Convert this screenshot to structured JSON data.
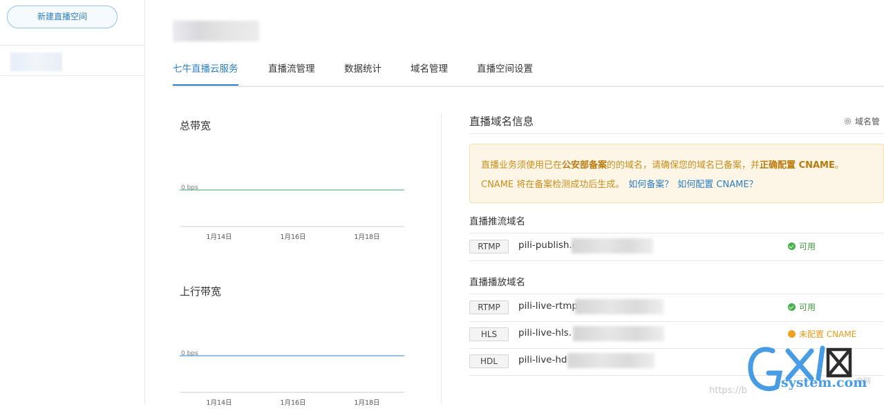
{
  "sidebar": {
    "new_space_label": "新建直播空间"
  },
  "tabs": [
    {
      "label": "七牛直播云服务",
      "active": true
    },
    {
      "label": "直播流管理",
      "active": false
    },
    {
      "label": "数据统计",
      "active": false
    },
    {
      "label": "域名管理",
      "active": false
    },
    {
      "label": "直播空间设置",
      "active": false
    }
  ],
  "charts": {
    "total_bandwidth": {
      "title": "总带宽"
    },
    "upstream_bandwidth": {
      "title": "上行带宽"
    }
  },
  "chart_data": [
    {
      "type": "line",
      "title": "总带宽",
      "x": [
        "1月14日",
        "1月16日",
        "1月18日"
      ],
      "series": [
        {
          "values": [
            0,
            0,
            0
          ]
        }
      ],
      "y_ticks": [
        "0 bps"
      ],
      "line_color": "#3aa06a",
      "grid": false
    },
    {
      "type": "line",
      "title": "上行带宽",
      "x": [
        "1月14日",
        "1月16日",
        "1月18日"
      ],
      "series": [
        {
          "values": [
            0,
            0,
            0
          ]
        }
      ],
      "y_ticks": [
        "0 bps"
      ],
      "line_color": "#2b7fc3",
      "grid": false
    }
  ],
  "domain_info": {
    "title": "直播域名信息",
    "manage_link": "域名管",
    "notice": {
      "line1_pre": "直播业务须使用已在",
      "line1_bold1": "公安部备案",
      "line1_mid": "的的域名，请确保您的域名已备案，并",
      "line1_bold2": "正确配置 CNAME",
      "line1_end": "。",
      "line2": "CNAME 将在备案检测成功后生成。",
      "link_filing": "如何备案？",
      "link_cname": "如何配置 CNAME？"
    },
    "publish_section": {
      "label": "直播推流域名",
      "rows": [
        {
          "protocol": "RTMP",
          "domain": "pili-publish.c",
          "status": "可用",
          "status_type": "ok"
        }
      ]
    },
    "playback_section": {
      "label": "直播播放域名",
      "rows": [
        {
          "protocol": "RTMP",
          "domain": "pili-live-rtmp",
          "status": "可用",
          "status_type": "ok"
        },
        {
          "protocol": "HLS",
          "domain": "pili-live-hls.",
          "status": "未配置 CNAME",
          "status_type": "warn"
        },
        {
          "protocol": "HDL",
          "domain": "pili-live-hd",
          "status": "",
          "status_type": "none"
        }
      ]
    }
  },
  "watermark": {
    "url": "https://b",
    "url_tail": "文网"
  },
  "colors": {
    "accent": "#2b7fc3",
    "warning_text": "#c98e1c",
    "ok_green": "#48b24a"
  }
}
